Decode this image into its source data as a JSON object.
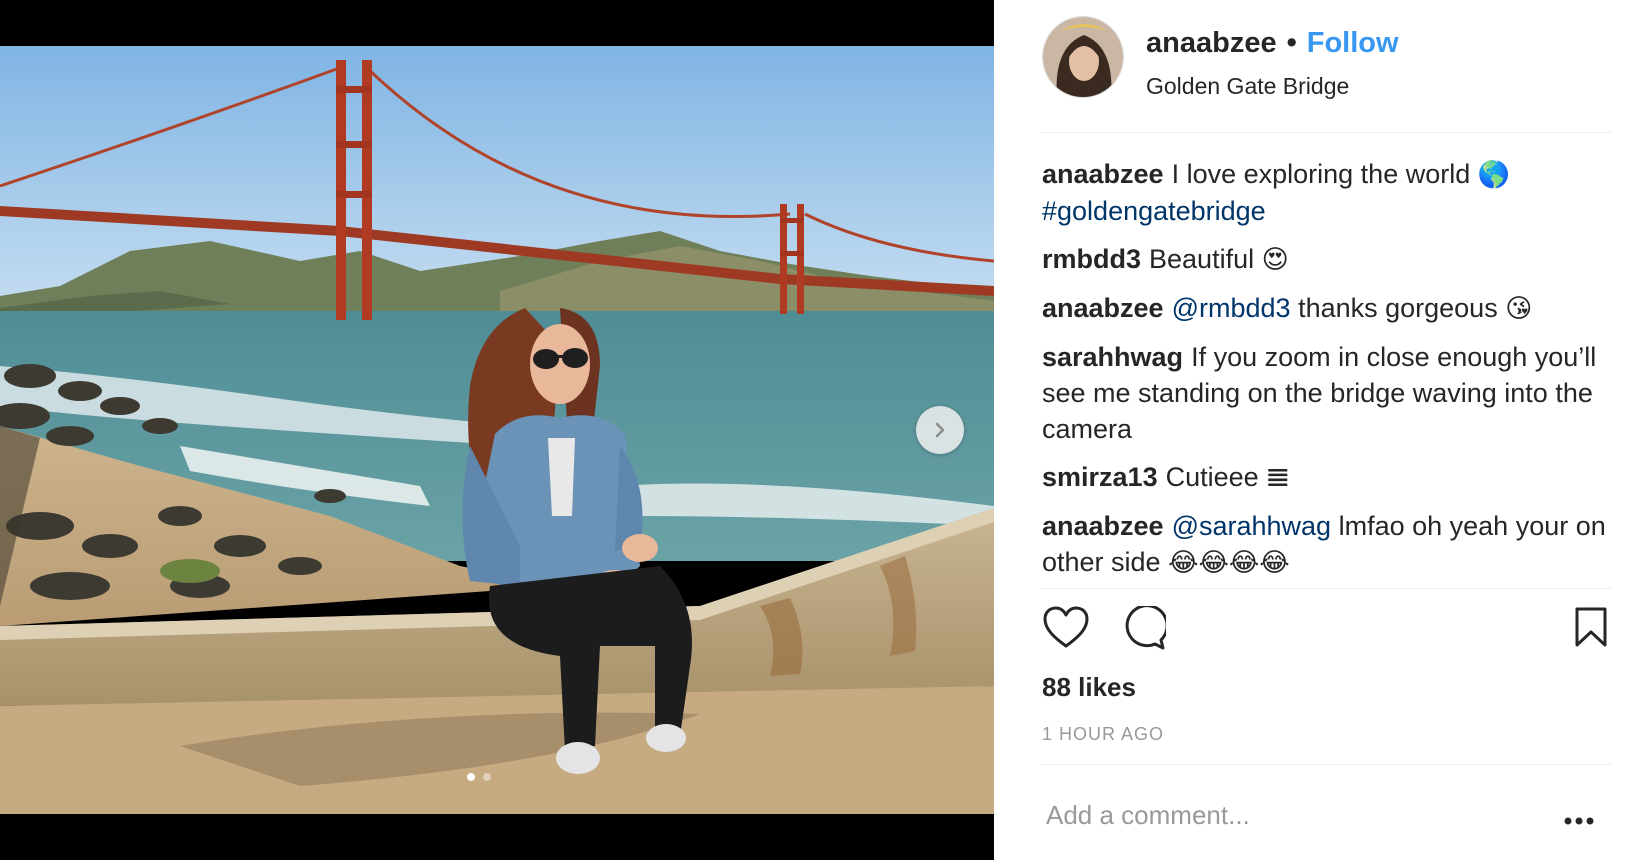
{
  "post": {
    "username": "anaabzee",
    "separator": "•",
    "follow_label": "Follow",
    "location": "Golden Gate Bridge",
    "likes": "88 likes",
    "time_ago": "1 HOUR AGO",
    "comment_placeholder": "Add a comment...",
    "carousel": {
      "current": 1,
      "total": 2
    }
  },
  "comments": [
    {
      "user": "anaabzee",
      "text": "I love exploring the world",
      "emoji": "🌎",
      "hashtag": "#goldengatebridge"
    },
    {
      "user": "rmbdd3",
      "text": "Beautiful",
      "emoji": "😍"
    },
    {
      "user": "anaabzee",
      "mention": "@rmbdd3",
      "text": "thanks gorgeous",
      "emoji": "😘"
    },
    {
      "user": "sarahhwag",
      "text": "If you zoom in close enough you’ll see me standing on the bridge waving into the camera"
    },
    {
      "user": "smirza13",
      "text": "Cutieee",
      "emoji": "𝌆"
    },
    {
      "user": "anaabzee",
      "mention": "@sarahhwag",
      "text": "lmfao oh yeah your on other side",
      "emoji": "😂😂😂😂"
    }
  ],
  "icons": {
    "like": "heart-icon",
    "comment": "comment-bubble-icon",
    "save": "bookmark-icon",
    "next": "chevron-right-icon",
    "more": "ellipsis-icon"
  },
  "colors": {
    "follow": "#3897f0",
    "link": "#003569",
    "text": "#262626",
    "muted": "#999999"
  }
}
